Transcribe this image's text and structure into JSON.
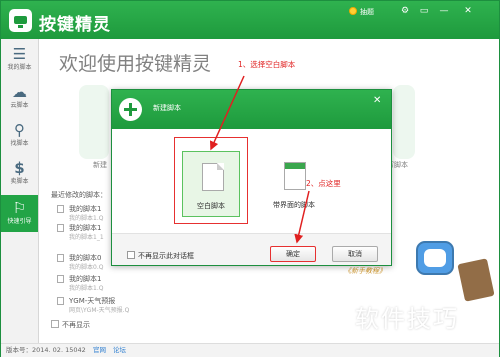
{
  "app": {
    "title": "按键精灵",
    "recharge_label": "抽题"
  },
  "window_controls": [
    "⚙",
    "▭",
    "—",
    "✕"
  ],
  "sidebar": {
    "items": [
      {
        "label": "我的脚本",
        "icon": "list-icon"
      },
      {
        "label": "云脚本",
        "icon": "cloud-icon"
      },
      {
        "label": "找脚本",
        "icon": "search-icon"
      },
      {
        "label": "卖脚本",
        "icon": "coin-icon"
      },
      {
        "label": "快速引导",
        "icon": "guide-icon",
        "active": true
      }
    ]
  },
  "main": {
    "welcome": "欢迎使用按键精灵",
    "bg_labels": [
      "新建",
      "写脚本"
    ],
    "recent_title": "最近修改的脚本：",
    "recent": [
      {
        "name": "我的脚本1",
        "sub": "我的脚本1.Q"
      },
      {
        "name": "我的脚本1",
        "sub": "我的脚本1_1"
      },
      {
        "name": "我的脚本0",
        "sub": "我的脚本0.Q"
      },
      {
        "name": "我的脚本1",
        "sub": "我的脚本1.Q"
      },
      {
        "name": "YGM-天气预报",
        "sub": "网页\\YGM-天气预报.Q"
      }
    ],
    "no_show": "不再显示"
  },
  "annotations": {
    "step1": "1、选择空白脚本",
    "step2": "2、点这里"
  },
  "dialog": {
    "title": "新建脚本",
    "close": "✕",
    "templates": [
      {
        "label": "空白脚本",
        "selected": true
      },
      {
        "label": "带界面的脚本",
        "selected": false
      }
    ],
    "dont_show": "不再显示此对话框",
    "ok": "确定",
    "cancel": "取消"
  },
  "promo": {
    "text": "《新手教程》"
  },
  "watermark": "软件技巧",
  "status": {
    "version": "版本号：2014. 02. 15042",
    "link1": "官网",
    "link2": "论坛"
  },
  "colors": {
    "brand": "#1e9a3d",
    "annotation": "#e02020"
  }
}
